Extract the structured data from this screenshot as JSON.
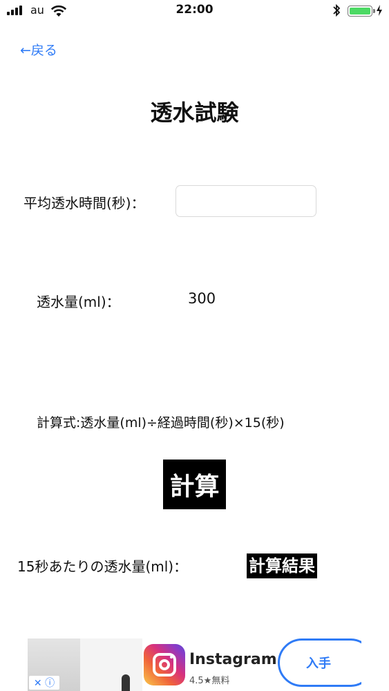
{
  "status_bar": {
    "carrier": "au",
    "time": "22:00",
    "battery_level": 1.0,
    "battery_color": "#4cd964",
    "icons": [
      "signal-icon",
      "wifi-icon",
      "bluetooth-icon",
      "battery-icon",
      "charging-bolt-icon"
    ]
  },
  "nav": {
    "back_label": "←戻る"
  },
  "title": "透水試験",
  "form": {
    "avg_time_label": "平均透水時間(秒)：",
    "avg_time_value": "",
    "volume_label": "透水量(ml)：",
    "volume_value": "300",
    "formula": "計算式:透水量(ml)÷経過時間(秒)×15(秒)",
    "calc_button": "計算",
    "result_label": "15秒あたりの透水量(ml)：",
    "result_value": "計算結果"
  },
  "ad": {
    "app_name": "Instagram",
    "rating_text": "4.5★無料",
    "get_label": "入手",
    "close_glyphs": "✕ ⓘ"
  },
  "colors": {
    "accent": "#2f7bf6",
    "button_bg": "#000000"
  }
}
